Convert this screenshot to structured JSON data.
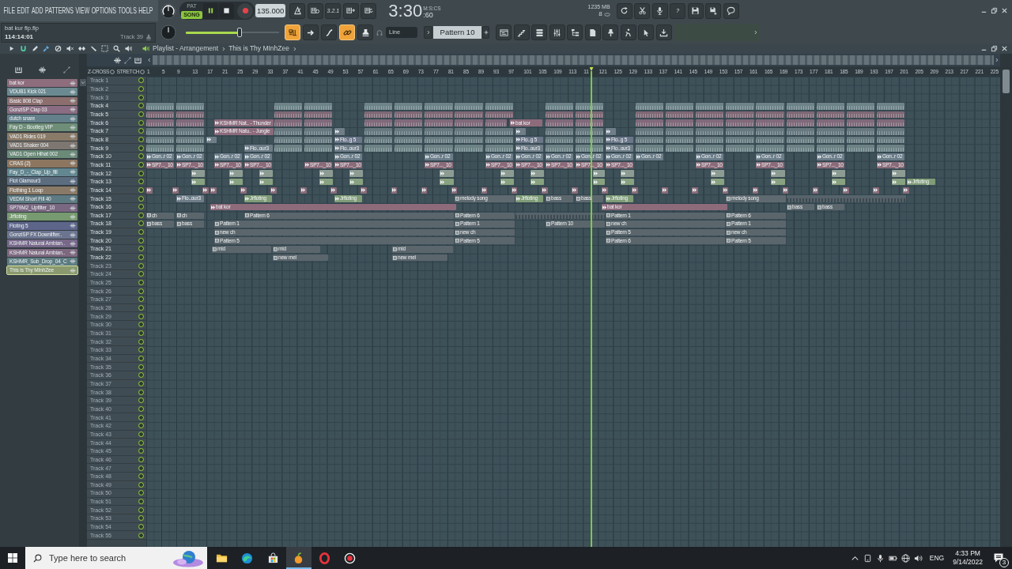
{
  "menu": [
    "FILE",
    "EDIT",
    "ADD",
    "PATTERNS",
    "VIEW",
    "OPTIONS",
    "TOOLS",
    "HELP"
  ],
  "file": {
    "name": "bat kur flp.flp",
    "position": "114:14:01",
    "hint": "Track 39"
  },
  "transport": {
    "modes": [
      {
        "label": "PAT",
        "selected": false
      },
      {
        "label": "SONG",
        "selected": true
      }
    ],
    "playing": true,
    "tempo": "135.000"
  },
  "toolbar": {
    "countdown": "3.2.1",
    "help": "?"
  },
  "clock": {
    "time": "3:30",
    "centiseconds": ":60",
    "unit": "M:S:CS"
  },
  "monitor": {
    "memory": "1235 MB",
    "cpu": "8"
  },
  "master_volume": {
    "level": 0.58
  },
  "toggles": [
    {
      "kind": "typing",
      "on": true
    },
    {
      "kind": "arrow",
      "on": false
    },
    {
      "kind": "curve",
      "on": false
    },
    {
      "kind": "link",
      "on": true
    },
    {
      "kind": "stamp",
      "on": false
    }
  ],
  "snap": {
    "value": "Line"
  },
  "pattern": {
    "value": "Pattern 10"
  },
  "playlist": {
    "title": "Playlist - Arrangement",
    "breadcrumb": "This is Thy MInhZee",
    "options": [
      {
        "label": "Z-CROSS",
        "checked": false
      },
      {
        "label": "STRETCH",
        "checked": false
      }
    ],
    "ruler": [
      "1",
      "5",
      "9",
      "13",
      "17",
      "21",
      "25",
      "29",
      "33",
      "37",
      "41",
      "45",
      "49",
      "53",
      "57",
      "61",
      "65",
      "69",
      "73",
      "77",
      "81",
      "85",
      "89",
      "93",
      "97",
      "101",
      "105",
      "109",
      "113",
      "11",
      "121",
      "125",
      "129",
      "133",
      "137",
      "141",
      "145",
      "149",
      "153",
      "157",
      "161",
      "165",
      "169",
      "173",
      "177",
      "181",
      "185",
      "189",
      "193",
      "197",
      "201",
      "205",
      "209",
      "213",
      "217",
      "221",
      "225"
    ],
    "channels": [
      {
        "name": "bat kor",
        "color": "#8e6d7d",
        "selected": false
      },
      {
        "name": "VDUB1 Kick 021",
        "color": "#6b8990",
        "selected": false
      },
      {
        "name": "Basic 808 Clap",
        "color": "#8c6e6e",
        "selected": false
      },
      {
        "name": "GonziSP Clap 03",
        "color": "#8a6d82",
        "selected": false
      },
      {
        "name": "dutch snare",
        "color": "#64808a",
        "selected": false
      },
      {
        "name": "Fay D - Bootleg VIP",
        "color": "#6f8e78",
        "selected": false
      },
      {
        "name": "VAD1 Rides 019",
        "color": "#8a7a68",
        "selected": false
      },
      {
        "name": "VAD1 Shaker 004",
        "color": "#7e7670",
        "selected": false
      },
      {
        "name": "VAD1 Open Hihat 002",
        "color": "#6b8a78",
        "selected": false
      },
      {
        "name": "CRAS (2)",
        "color": "#8d7660",
        "selected": false
      },
      {
        "name": "Fay_D_-_Clap_Up_fill",
        "color": "#638790",
        "selected": false
      },
      {
        "name": "Flot Glamour3",
        "color": "#5c6d80",
        "selected": false
      },
      {
        "name": "Flothing 1 Loop",
        "color": "#897967",
        "selected": false
      },
      {
        "name": "VEDM Short Fill 40",
        "color": "#5e7a82",
        "selected": false
      },
      {
        "name": "SP79M2_Upfilter_10",
        "color": "#7a6882",
        "selected": false
      },
      {
        "name": "Jrfloting",
        "color": "#779a70",
        "selected": false
      },
      {
        "name": "Floting 5",
        "color": "#5d668a",
        "selected": false
      },
      {
        "name": "GonziSP FX Downlifter..",
        "color": "#6c7590",
        "selected": false
      },
      {
        "name": "KSHMR Natural Ambian..",
        "color": "#77688a",
        "selected": false
      },
      {
        "name": "KSHMR Natural Ambian..",
        "color": "#7e6880",
        "selected": false
      },
      {
        "name": "KSHMR_Sub_Drop_04_C",
        "color": "#5d7c82",
        "selected": false
      },
      {
        "name": "This is Thy MInhZee",
        "color": "#8a9a6e",
        "selected": true
      }
    ],
    "tracks": [
      {
        "name": "Track 1",
        "muted": false
      },
      {
        "name": "Track 2",
        "muted": false
      },
      {
        "name": "Track 3",
        "muted": false
      },
      {
        "name": "Track 4",
        "muted": false,
        "clips": [
          {
            "kind": "waveform",
            "color": "#6d8388"
          },
          {
            "kind": "waveform",
            "color": "#6d8388"
          },
          {
            "kind": "waveform",
            "color": "#6d8388"
          },
          {
            "kind": "waveform",
            "color": "#6d8388"
          },
          {
            "kind": "waveform",
            "color": "#6d8388"
          },
          {
            "kind": "waveform",
            "color": "#6d8388"
          },
          {
            "kind": "waveform",
            "color": "#6d8388"
          },
          {
            "kind": "waveform",
            "color": "#6d8388"
          },
          {
            "kind": "waveform",
            "color": "#6d8388"
          },
          {
            "kind": "waveform",
            "color": "#6d8388"
          },
          {
            "kind": "waveform",
            "color": "#6d8388"
          },
          {
            "kind": "waveform",
            "color": "#6d8388"
          },
          {
            "kind": "waveform",
            "color": "#6d8388"
          },
          {
            "kind": "waveform",
            "color": "#6d8388"
          },
          {
            "kind": "waveform",
            "color": "#6d8388"
          },
          {
            "kind": "waveform",
            "color": "#6d8388"
          },
          {
            "kind": "waveform",
            "color": "#6d8388"
          },
          {
            "kind": "waveform",
            "color": "#6d8388"
          },
          {
            "kind": "waveform",
            "color": "#6d8388"
          },
          {
            "kind": "waveform",
            "color": "#6d8388"
          }
        ]
      },
      {
        "name": "Track 5",
        "muted": false,
        "clips": [
          {
            "kind": "waveform",
            "color": "#7f6875"
          },
          {
            "kind": "waveform",
            "color": "#7f6875"
          },
          {
            "kind": "waveform",
            "color": "#7f6875"
          },
          {
            "kind": "waveform",
            "color": "#7f6875"
          },
          {
            "kind": "waveform",
            "color": "#7f6875"
          },
          {
            "kind": "waveform",
            "color": "#7f6875"
          },
          {
            "kind": "waveform",
            "color": "#7f6875"
          },
          {
            "kind": "waveform",
            "color": "#7f6875"
          },
          {
            "kind": "waveform",
            "color": "#7f6875"
          },
          {
            "kind": "waveform",
            "color": "#7f6875"
          },
          {
            "kind": "waveform",
            "color": "#7f6875"
          },
          {
            "kind": "waveform",
            "color": "#7f6875"
          },
          {
            "kind": "waveform",
            "color": "#7f6875"
          },
          {
            "kind": "waveform",
            "color": "#7f6875"
          },
          {
            "kind": "waveform",
            "color": "#7f6875"
          },
          {
            "kind": "waveform",
            "color": "#7f6875"
          },
          {
            "kind": "waveform",
            "color": "#7f6875"
          },
          {
            "kind": "waveform",
            "color": "#7f6875"
          },
          {
            "kind": "waveform",
            "color": "#7f6875"
          },
          {
            "kind": "waveform",
            "color": "#7f6875"
          }
        ]
      },
      {
        "name": "Track 6",
        "muted": false,
        "clips": [
          {
            "kind": "waveform",
            "color": "#80697a"
          },
          {
            "kind": "waveform",
            "color": "#80697a"
          },
          {
            "kind": "audio",
            "label": "KSHMR Nat.. - Thunder",
            "color": "#8c6b7c"
          },
          {
            "kind": "waveform",
            "color": "#80697a"
          },
          {
            "kind": "waveform",
            "color": "#80697a"
          },
          {
            "kind": "waveform",
            "color": "#80697a"
          },
          {
            "kind": "waveform",
            "color": "#80697a"
          },
          {
            "kind": "waveform",
            "color": "#80697a"
          },
          {
            "kind": "waveform",
            "color": "#80697a"
          },
          {
            "kind": "waveform",
            "color": "#80697a"
          },
          {
            "kind": "audio",
            "label": "bat kor",
            "color": "#8d6b7b"
          },
          {
            "kind": "waveform",
            "color": "#80697a"
          },
          {
            "kind": "waveform",
            "color": "#80697a"
          },
          {
            "kind": "waveform",
            "color": "#80697a"
          },
          {
            "kind": "waveform",
            "color": "#80697a"
          },
          {
            "kind": "waveform",
            "color": "#80697a"
          },
          {
            "kind": "waveform",
            "color": "#80697a"
          },
          {
            "kind": "waveform",
            "color": "#80697a"
          },
          {
            "kind": "waveform",
            "color": "#80697a"
          },
          {
            "kind": "waveform",
            "color": "#80697a"
          },
          {
            "kind": "waveform",
            "color": "#80697a"
          },
          {
            "kind": "waveform",
            "color": "#80697a"
          }
        ]
      },
      {
        "name": "Track 7",
        "muted": false,
        "clips": [
          {
            "kind": "waveform",
            "color": "#67787f"
          },
          {
            "kind": "waveform",
            "color": "#67787f"
          },
          {
            "kind": "audio",
            "label": "KSHMR Natu.. - Jungle",
            "color": "#8c6b7c"
          },
          {
            "kind": "waveform",
            "color": "#67787f"
          },
          {
            "kind": "waveform",
            "color": "#67787f"
          },
          {
            "kind": "audio",
            "color": "#6f7e88"
          },
          {
            "kind": "waveform",
            "color": "#67787f"
          },
          {
            "kind": "waveform",
            "color": "#67787f"
          },
          {
            "kind": "waveform",
            "color": "#67787f"
          },
          {
            "kind": "waveform",
            "color": "#67787f"
          },
          {
            "kind": "waveform",
            "color": "#67787f"
          },
          {
            "kind": "audio",
            "color": "#6f7e88"
          },
          {
            "kind": "waveform",
            "color": "#67787f"
          },
          {
            "kind": "waveform",
            "color": "#67787f"
          },
          {
            "kind": "audio",
            "color": "#6f7e88"
          },
          {
            "kind": "waveform",
            "color": "#67787f"
          },
          {
            "kind": "waveform",
            "color": "#67787f"
          },
          {
            "kind": "waveform",
            "color": "#67787f"
          },
          {
            "kind": "waveform",
            "color": "#67787f"
          },
          {
            "kind": "waveform",
            "color": "#67787f"
          },
          {
            "kind": "waveform",
            "color": "#67787f"
          },
          {
            "kind": "waveform",
            "color": "#67787f"
          },
          {
            "kind": "waveform",
            "color": "#67787f"
          },
          {
            "kind": "waveform",
            "color": "#67787f"
          }
        ]
      },
      {
        "name": "Track 8",
        "muted": false,
        "clips": [
          {
            "kind": "waveform",
            "color": "#687b80"
          },
          {
            "kind": "waveform",
            "color": "#687b80"
          },
          {
            "kind": "audio",
            "color": "#6f7e88"
          },
          {
            "kind": "waveform",
            "color": "#687b80"
          },
          {
            "kind": "waveform",
            "color": "#687b80"
          },
          {
            "kind": "audio",
            "label": "Flo..g 5",
            "color": "#6b7689"
          },
          {
            "kind": "waveform",
            "color": "#687b80"
          },
          {
            "kind": "waveform",
            "color": "#687b80"
          },
          {
            "kind": "waveform",
            "color": "#687b80"
          },
          {
            "kind": "waveform",
            "color": "#687b80"
          },
          {
            "kind": "waveform",
            "color": "#687b80"
          },
          {
            "kind": "audio",
            "label": "Flo..g 5",
            "color": "#6b7689"
          },
          {
            "kind": "waveform",
            "color": "#687b80"
          },
          {
            "kind": "waveform",
            "color": "#687b80"
          },
          {
            "kind": "audio",
            "label": "Flo..g 5",
            "color": "#6b7689"
          },
          {
            "kind": "waveform",
            "color": "#687b80"
          },
          {
            "kind": "waveform",
            "color": "#687b80"
          },
          {
            "kind": "waveform",
            "color": "#687b80"
          },
          {
            "kind": "waveform",
            "color": "#687b80"
          },
          {
            "kind": "waveform",
            "color": "#687b80"
          },
          {
            "kind": "waveform",
            "color": "#687b80"
          },
          {
            "kind": "waveform",
            "color": "#687b80"
          },
          {
            "kind": "waveform",
            "color": "#687b80"
          },
          {
            "kind": "waveform",
            "color": "#687b80"
          }
        ]
      },
      {
        "name": "Track 9",
        "muted": false,
        "clips": [
          {
            "kind": "waveform",
            "color": "#6c8285"
          },
          {
            "kind": "waveform",
            "color": "#6c8285"
          },
          {
            "kind": "audio",
            "label": "Flo..our3",
            "color": "#6e7d88"
          },
          {
            "kind": "waveform",
            "color": "#6c8285"
          },
          {
            "kind": "waveform",
            "color": "#6c8285"
          },
          {
            "kind": "audio",
            "label": "Flo..our3",
            "color": "#6e7d88"
          },
          {
            "kind": "waveform",
            "color": "#6c8285"
          },
          {
            "kind": "waveform",
            "color": "#6c8285"
          },
          {
            "kind": "waveform",
            "color": "#6c8285"
          },
          {
            "kind": "waveform",
            "color": "#6c8285"
          },
          {
            "kind": "waveform",
            "color": "#6c8285"
          },
          {
            "kind": "audio",
            "label": "Flo..our3",
            "color": "#6e7d88"
          },
          {
            "kind": "waveform",
            "color": "#6c8285"
          },
          {
            "kind": "waveform",
            "color": "#6c8285"
          },
          {
            "kind": "audio",
            "label": "Flo..our3",
            "color": "#6e7d88"
          },
          {
            "kind": "waveform",
            "color": "#6c8285"
          },
          {
            "kind": "waveform",
            "color": "#6c8285"
          },
          {
            "kind": "waveform",
            "color": "#6c8285"
          },
          {
            "kind": "waveform",
            "color": "#6c8285"
          },
          {
            "kind": "waveform",
            "color": "#6c8285"
          },
          {
            "kind": "waveform",
            "color": "#6c8285"
          },
          {
            "kind": "waveform",
            "color": "#6c8285"
          },
          {
            "kind": "waveform",
            "color": "#6c8285"
          },
          {
            "kind": "waveform",
            "color": "#6c8285"
          }
        ]
      },
      {
        "name": "Track 10",
        "muted": false,
        "clips": [
          {
            "kind": "audio",
            "label": "Gon..r 02",
            "color": "#6b7d89"
          },
          {
            "kind": "audio",
            "label": "Gon..r 02",
            "color": "#6b7d89"
          },
          {
            "kind": "audio",
            "label": "Gon..r 02",
            "color": "#6b7d89"
          },
          {
            "kind": "audio",
            "label": "Gon..r 02",
            "color": "#6b7d89"
          },
          {
            "kind": "audio",
            "label": "Gon..r 02",
            "color": "#6b7d89"
          },
          {
            "kind": "audio",
            "label": "Gon..r 02",
            "color": "#6b7d89"
          },
          {
            "kind": "audio",
            "label": "Gon..r 02",
            "color": "#6b7d89"
          },
          {
            "kind": "audio",
            "label": "Gon..r 02",
            "color": "#6b7d89"
          },
          {
            "kind": "audio",
            "label": "Gon..r 02",
            "color": "#6b7d89"
          },
          {
            "kind": "audio",
            "label": "Gon..r 02",
            "color": "#6b7d89"
          },
          {
            "kind": "audio",
            "label": "Gon..r 02",
            "color": "#6b7d89"
          },
          {
            "kind": "audio",
            "label": "Gon..r 02",
            "color": "#6b7d89"
          },
          {
            "kind": "audio",
            "label": "Gon..r 02",
            "color": "#6b7d89"
          },
          {
            "kind": "audio",
            "label": "Gon..r 02",
            "color": "#6b7d89"
          },
          {
            "kind": "audio",
            "label": "Gon..r 02",
            "color": "#6b7d89"
          },
          {
            "kind": "audio",
            "label": "Gon..r 02",
            "color": "#6b7d89"
          }
        ]
      },
      {
        "name": "Track 11",
        "muted": false,
        "clips": [
          {
            "kind": "audio",
            "label": "SP7..._10",
            "color": "#8b6b79"
          },
          {
            "kind": "audio",
            "label": "SP7..._10",
            "color": "#8b6b79"
          },
          {
            "kind": "audio",
            "label": "SP7..._10",
            "color": "#8b6b79"
          },
          {
            "kind": "audio",
            "label": "SP7..._10",
            "color": "#8b6b79"
          },
          {
            "kind": "audio",
            "label": "SP7..._10",
            "color": "#8b6b79"
          },
          {
            "kind": "audio",
            "label": "SP7..._10",
            "color": "#8b6b79"
          },
          {
            "kind": "audio",
            "label": "SP7..._10",
            "color": "#8b6b79"
          },
          {
            "kind": "audio",
            "label": "SP7..._10",
            "color": "#8b6b79"
          },
          {
            "kind": "audio",
            "label": "SP7..._10",
            "color": "#8b6b79"
          },
          {
            "kind": "audio",
            "label": "SP7..._10",
            "color": "#8b6b79"
          },
          {
            "kind": "audio",
            "label": "SP7..._10",
            "color": "#8b6b79"
          },
          {
            "kind": "audio",
            "label": "SP7..._10",
            "color": "#8b6b79"
          },
          {
            "kind": "audio",
            "label": "SP7..._10",
            "color": "#8b6b79"
          },
          {
            "kind": "audio",
            "label": "SP7..._10",
            "color": "#8b6b79"
          },
          {
            "kind": "audio",
            "label": "SP7..._10",
            "color": "#8b6b79"
          },
          {
            "kind": "audio",
            "label": "SP7..._10",
            "color": "#8b6b79"
          }
        ]
      },
      {
        "name": "Track 12",
        "muted": false,
        "clips": [
          {
            "kind": "audio",
            "color": "#8d9c93"
          },
          {
            "kind": "audio",
            "color": "#8d9c93"
          },
          {
            "kind": "audio",
            "color": "#8d9c93"
          },
          {
            "kind": "audio",
            "color": "#8d9c93"
          },
          {
            "kind": "audio",
            "color": "#8d9c93"
          },
          {
            "kind": "audio",
            "color": "#8d9c93"
          },
          {
            "kind": "audio",
            "color": "#8d9c93"
          },
          {
            "kind": "audio",
            "color": "#8d9c93"
          },
          {
            "kind": "audio",
            "color": "#8d9c93"
          },
          {
            "kind": "audio",
            "color": "#8d9c93"
          },
          {
            "kind": "audio",
            "color": "#8d9c93"
          },
          {
            "kind": "audio",
            "color": "#8d9c93"
          },
          {
            "kind": "audio",
            "color": "#8d9c93"
          },
          {
            "kind": "audio",
            "color": "#8d9c93"
          }
        ]
      },
      {
        "name": "Track 13",
        "muted": false,
        "clips": [
          {
            "kind": "audio",
            "color": "#88a180"
          },
          {
            "kind": "audio",
            "color": "#88a180"
          },
          {
            "kind": "audio",
            "color": "#88a180"
          },
          {
            "kind": "audio",
            "color": "#88a180"
          },
          {
            "kind": "audio",
            "color": "#88a180"
          },
          {
            "kind": "audio",
            "color": "#88a180"
          },
          {
            "kind": "audio",
            "color": "#88a180"
          },
          {
            "kind": "audio",
            "color": "#88a180"
          },
          {
            "kind": "audio",
            "color": "#88a180"
          },
          {
            "kind": "audio",
            "color": "#88a180"
          },
          {
            "kind": "audio",
            "color": "#88a180"
          },
          {
            "kind": "audio",
            "color": "#88a180"
          },
          {
            "kind": "audio",
            "color": "#88a180"
          },
          {
            "kind": "audio",
            "color": "#88a180"
          },
          {
            "kind": "audio",
            "label": "Jrfloting",
            "color": "#7f9c77"
          }
        ]
      },
      {
        "name": "Track 14",
        "muted": false,
        "clips": [
          {
            "kind": "audio",
            "color": "#8a6c79"
          },
          {
            "kind": "audio",
            "color": "#8a6c79"
          },
          {
            "kind": "audio",
            "color": "#8a6c79"
          },
          {
            "kind": "audio",
            "color": "#8a6c79"
          },
          {
            "kind": "audio",
            "color": "#8a6c79"
          },
          {
            "kind": "audio",
            "color": "#8a6c79"
          },
          {
            "kind": "audio",
            "color": "#8a6c79"
          },
          {
            "kind": "audio",
            "color": "#8a6c79"
          },
          {
            "kind": "audio",
            "color": "#8a6c79"
          },
          {
            "kind": "audio",
            "color": "#8a6c79"
          },
          {
            "kind": "audio",
            "color": "#8a6c79"
          },
          {
            "kind": "audio",
            "color": "#8a6c79"
          },
          {
            "kind": "audio",
            "color": "#8a6c79"
          },
          {
            "kind": "audio",
            "color": "#8a6c79"
          },
          {
            "kind": "audio",
            "color": "#8a6c79"
          },
          {
            "kind": "audio",
            "color": "#8a6c79"
          },
          {
            "kind": "audio",
            "color": "#8a6c79"
          },
          {
            "kind": "audio",
            "color": "#8a6c79"
          },
          {
            "kind": "audio",
            "color": "#8a6c79"
          },
          {
            "kind": "audio",
            "color": "#8a6c79"
          },
          {
            "kind": "audio",
            "color": "#8a6c79"
          },
          {
            "kind": "audio",
            "color": "#8a6c79"
          },
          {
            "kind": "audio",
            "color": "#8a6c79"
          },
          {
            "kind": "audio",
            "color": "#8a6c79"
          },
          {
            "kind": "audio",
            "color": "#8a6c79"
          },
          {
            "kind": "audio",
            "color": "#8a6c79"
          },
          {
            "kind": "audio",
            "color": "#8a6c79"
          }
        ]
      },
      {
        "name": "Track 15",
        "muted": false,
        "clips": [
          {
            "kind": "audio",
            "label": "Flo..our3",
            "color": "#6e7d88"
          },
          {
            "kind": "audio",
            "label": "Jrfloting",
            "color": "#7f9c77"
          },
          {
            "kind": "audio",
            "label": "Jrfloting",
            "color": "#7f9c77"
          },
          {
            "kind": "pattern",
            "label": "melody song",
            "color": "#5f6a70"
          },
          {
            "kind": "audio",
            "label": "Jrfloting",
            "color": "#7f9c77"
          },
          {
            "kind": "pattern",
            "label": "bass",
            "color": "#5d686e"
          },
          {
            "kind": "pattern",
            "label": "bass",
            "color": "#5d686e"
          },
          {
            "kind": "audio",
            "label": "Jrfloting",
            "color": "#7f9c77"
          },
          {
            "kind": "pattern",
            "label": "melody song",
            "color": "#5f6a70"
          },
          {
            "kind": "notes",
            "color": "#56636a"
          }
        ]
      },
      {
        "name": "Track 16",
        "muted": false,
        "clips": [
          {
            "kind": "audio",
            "label": "bat kor",
            "color": "#8d6b7b"
          },
          {
            "kind": "audio",
            "label": "bat kor",
            "color": "#8d6b7b"
          },
          {
            "kind": "pattern",
            "label": "bass",
            "color": "#5d686e"
          },
          {
            "kind": "pattern",
            "label": "bass",
            "color": "#5d686e"
          }
        ]
      },
      {
        "name": "Track 17",
        "muted": false,
        "clips": [
          {
            "kind": "pattern",
            "label": "ch",
            "color": "#5b666c"
          },
          {
            "kind": "pattern",
            "label": "ch",
            "color": "#5b666c"
          },
          {
            "kind": "pattern",
            "label": "Pattern 6",
            "color": "#5b666c"
          },
          {
            "kind": "pattern",
            "label": "Pattern 6",
            "color": "#5b666c"
          },
          {
            "kind": "notes",
            "color": "#56636a"
          },
          {
            "kind": "pattern",
            "label": "Pattern 1",
            "color": "#5b666c"
          },
          {
            "kind": "pattern",
            "label": "Pattern 6",
            "color": "#5b666c"
          }
        ]
      },
      {
        "name": "Track 18",
        "muted": false,
        "clips": [
          {
            "kind": "pattern",
            "label": "bass",
            "color": "#5b666c"
          },
          {
            "kind": "pattern",
            "label": "bass",
            "color": "#5b666c"
          },
          {
            "kind": "pattern",
            "label": "Pattern 1",
            "color": "#5b666c"
          },
          {
            "kind": "pattern",
            "label": "Pattern 1",
            "color": "#5b666c"
          },
          {
            "kind": "pattern",
            "label": "Pattern 10",
            "color": "#5b666c"
          },
          {
            "kind": "pattern",
            "label": "new ch",
            "color": "#5b666c"
          },
          {
            "kind": "pattern",
            "label": "Pattern 1",
            "color": "#5b666c"
          }
        ]
      },
      {
        "name": "Track 19",
        "muted": false,
        "clips": [
          {
            "kind": "pattern",
            "label": "new ch",
            "color": "#5b666c"
          },
          {
            "kind": "pattern",
            "label": "new ch",
            "color": "#5b666c"
          },
          {
            "kind": "pattern",
            "label": "Pattern 5",
            "color": "#5b666c"
          },
          {
            "kind": "pattern",
            "label": "new ch",
            "color": "#5b666c"
          }
        ]
      },
      {
        "name": "Track 20",
        "muted": false,
        "clips": [
          {
            "kind": "pattern",
            "label": "Pattern 5",
            "color": "#5b666c"
          },
          {
            "kind": "pattern",
            "label": "Pattern 5",
            "color": "#5b666c"
          },
          {
            "kind": "pattern",
            "label": "Pattern 6",
            "color": "#5b666c"
          },
          {
            "kind": "pattern",
            "label": "Pattern 5",
            "color": "#5b666c"
          }
        ]
      },
      {
        "name": "Track 21",
        "muted": false,
        "clips": [
          {
            "kind": "pattern",
            "label": "mid",
            "color": "#5b666c"
          },
          {
            "kind": "pattern",
            "label": "mid",
            "color": "#5b666c"
          },
          {
            "kind": "pattern",
            "label": "mid",
            "color": "#5b666c"
          }
        ]
      },
      {
        "name": "Track 22",
        "muted": false,
        "clips": [
          {
            "kind": "pattern",
            "label": "new mel",
            "color": "#5b666c"
          },
          {
            "kind": "pattern",
            "label": "new mel",
            "color": "#5b666c"
          }
        ]
      },
      {
        "name": "Track 23",
        "muted": false
      },
      {
        "name": "Track 24",
        "muted": false
      },
      {
        "name": "Track 25",
        "muted": false
      },
      {
        "name": "Track 26",
        "muted": false
      },
      {
        "name": "Track 27",
        "muted": false
      },
      {
        "name": "Track 28",
        "muted": false
      },
      {
        "name": "Track 29",
        "muted": false
      },
      {
        "name": "Track 30",
        "muted": false
      },
      {
        "name": "Track 31",
        "muted": false
      },
      {
        "name": "Track 32",
        "muted": false
      },
      {
        "name": "Track 33",
        "muted": false
      },
      {
        "name": "Track 34",
        "muted": false
      },
      {
        "name": "Track 35",
        "muted": false
      },
      {
        "name": "Track 36",
        "muted": false
      },
      {
        "name": "Track 37",
        "muted": false
      },
      {
        "name": "Track 38",
        "muted": false
      },
      {
        "name": "Track 39",
        "muted": false
      },
      {
        "name": "Track 40",
        "muted": false
      },
      {
        "name": "Track 41",
        "muted": false
      },
      {
        "name": "Track 42",
        "muted": false
      },
      {
        "name": "Track 43",
        "muted": false
      },
      {
        "name": "Track 44",
        "muted": false
      },
      {
        "name": "Track 45",
        "muted": false
      },
      {
        "name": "Track 46",
        "muted": false
      },
      {
        "name": "Track 47",
        "muted": false
      },
      {
        "name": "Track 48",
        "muted": false
      },
      {
        "name": "Track 49",
        "muted": false
      },
      {
        "name": "Track 50",
        "muted": false
      },
      {
        "name": "Track 51",
        "muted": false
      },
      {
        "name": "Track 52",
        "muted": false
      },
      {
        "name": "Track 53",
        "muted": false
      },
      {
        "name": "Track 54",
        "muted": false
      },
      {
        "name": "Track 55",
        "muted": false
      }
    ]
  },
  "taskbar": {
    "search": {
      "placeholder": "Type here to search"
    },
    "apps": [
      {
        "kind": "folder",
        "selected": false
      },
      {
        "kind": "swirl",
        "selected": false
      },
      {
        "kind": "bag",
        "selected": false
      },
      {
        "kind": "fruit",
        "selected": true
      },
      {
        "kind": "ring",
        "selected": false
      },
      {
        "kind": "recorder",
        "selected": false
      }
    ],
    "language": "ENG",
    "time": "4:33 PM",
    "date": "9/14/2022",
    "notifications": "3"
  }
}
